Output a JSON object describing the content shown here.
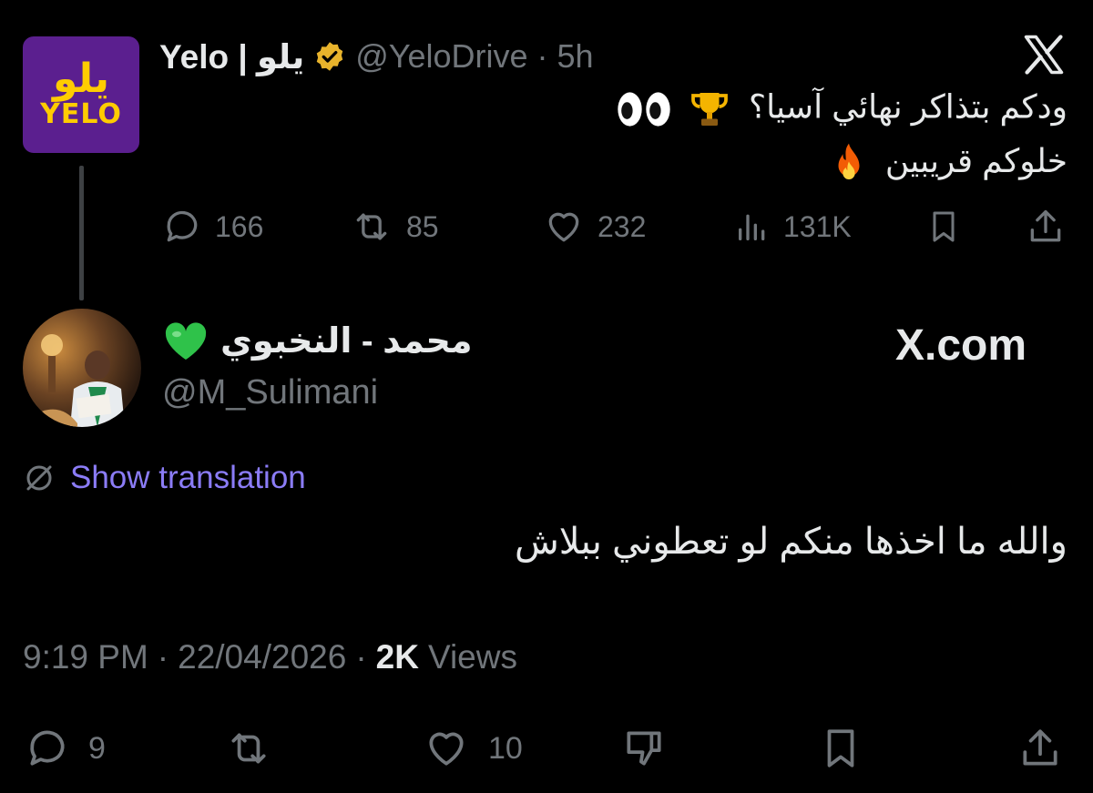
{
  "parent_tweet": {
    "logo": {
      "arabic": "يلو",
      "latin": "YELO",
      "bg_color": "#5b1f8f",
      "fg_color": "#ffcc00"
    },
    "display_name": "Yelo | يلو",
    "verified_icon": "gold-verified-badge",
    "handle": "@YeloDrive",
    "separator": "·",
    "time": "5h",
    "platform_icon": "x-logo-icon",
    "text_line1": "ودكم بتذاكر نهائي آسيا؟",
    "text_line1_emojis": [
      "trophy",
      "eyes"
    ],
    "text_line2": "خلوكم قريبين",
    "text_line2_emojis": [
      "fire"
    ],
    "actions": {
      "replies": "166",
      "reposts": "85",
      "likes": "232",
      "views": "131K"
    }
  },
  "reply_tweet": {
    "display_name": "محمد - النخبوي",
    "name_emoji": "green-heart",
    "handle": "@M_Sulimani",
    "site_label": "X.com",
    "translate_label": "Show translation",
    "text": "والله ما اخذها منكم لو تعطوني ببلاش",
    "meta": {
      "time": "9:19 PM",
      "sep1": "·",
      "date": "22/04/2026",
      "sep2": "·",
      "views_count": "2K",
      "views_label": "Views"
    },
    "actions": {
      "replies": "9",
      "likes": "10"
    }
  },
  "colors": {
    "background": "#000000",
    "text": "#e7e9ea",
    "muted": "#71767b",
    "link": "#8b7cf6",
    "thread_line": "#3e4144"
  }
}
